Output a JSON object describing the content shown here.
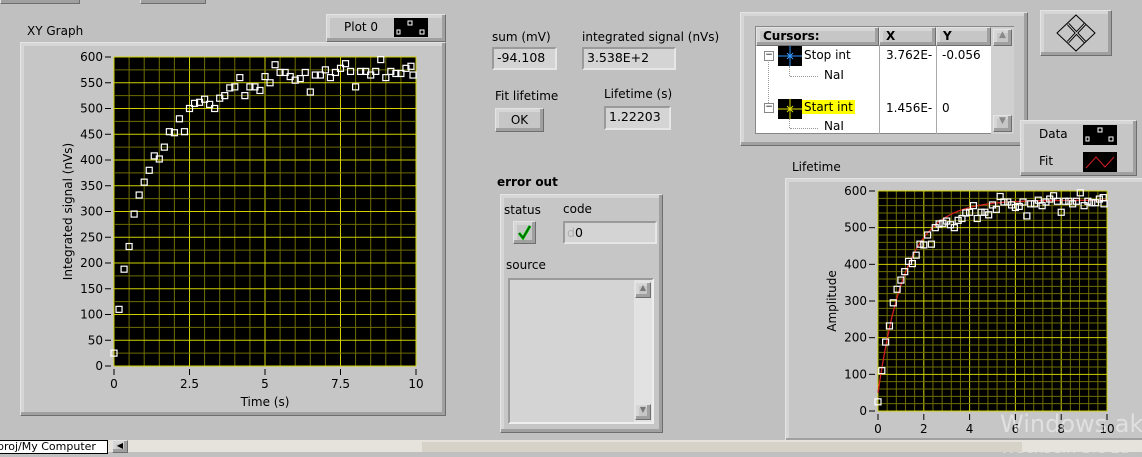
{
  "xy_graph": {
    "label": "XY Graph",
    "legend": {
      "plot_name": "Plot 0"
    },
    "chart_data": {
      "type": "scatter",
      "xlabel": "Time (s)",
      "ylabel": "Integrated signal (nVs)",
      "xlim": [
        0,
        10
      ],
      "ylim": [
        0,
        600
      ],
      "xticks": [
        "0",
        "2.5",
        "5",
        "7.5",
        "10"
      ],
      "yticks": [
        "0",
        "50",
        "100",
        "150",
        "200",
        "250",
        "300",
        "350",
        "400",
        "450",
        "500",
        "550",
        "600"
      ],
      "grid": true,
      "background": "#000000",
      "grid_color": "#c8c800",
      "marker_color": "#ffffff",
      "x": [
        0,
        0.2,
        0.4,
        0.6,
        0.8,
        1.0,
        1.2,
        1.4,
        1.6,
        1.8,
        2.0,
        2.2,
        2.4,
        2.6,
        2.8,
        3.0,
        3.2,
        3.4,
        3.6,
        3.8,
        4.0,
        4.2,
        4.4,
        4.6,
        4.8,
        5.0,
        5.2,
        5.4,
        5.6,
        5.8,
        6.0,
        6.2,
        6.4,
        6.6,
        6.8,
        7.0,
        7.2,
        7.4,
        7.6,
        7.8,
        8.0,
        8.2,
        8.4,
        8.6,
        8.8,
        9.0,
        9.2,
        9.4,
        9.6,
        9.8,
        10.0
      ],
      "y": [
        25,
        110,
        188,
        232,
        295,
        332,
        357,
        380,
        408,
        402,
        425,
        455,
        453,
        480,
        455,
        500,
        510,
        512,
        518,
        508,
        500,
        520,
        525,
        540,
        542,
        560,
        525,
        542,
        542,
        535,
        562,
        550,
        585,
        570,
        570,
        562,
        555,
        558,
        570,
        532,
        565,
        565,
        575,
        560,
        570,
        578,
        587,
        572,
        542,
        572,
        572,
        565,
        572,
        595,
        560,
        572,
        568,
        568,
        578,
        582,
        565
      ]
    }
  },
  "sum": {
    "label": "sum (mV)",
    "value": "-94.108"
  },
  "integrated_signal": {
    "label": "integrated signal (nVs)",
    "value": "3.538E+2"
  },
  "fit_lifetime": {
    "label": "Fit lifetime",
    "button": "OK"
  },
  "lifetime_value": {
    "label": "Lifetime (s)",
    "value": "1.22203"
  },
  "error_out": {
    "label": "error out",
    "status_label": "status",
    "status": true,
    "code_label": "code",
    "code_prefix": "d",
    "code": "0",
    "source_label": "source",
    "source": ""
  },
  "cursors": {
    "headers": [
      "Cursors:",
      "X",
      "Y"
    ],
    "items": [
      {
        "name": "Stop int",
        "x": "3.762E-",
        "y": "-0.056",
        "plot": "NaI",
        "color": "#3399ff",
        "highlight": false
      },
      {
        "name": "Start int",
        "x": "1.456E-",
        "y": "0",
        "plot": "NaI",
        "color": "#e0e000",
        "highlight": true
      }
    ]
  },
  "lifetime_graph": {
    "label": "Lifetime",
    "legend": [
      {
        "name": "Data"
      },
      {
        "name": "Fit",
        "color": "#d02020"
      }
    ],
    "chart_data": {
      "type": "scatter",
      "xlabel": "",
      "ylabel": "Amplitude",
      "xlim": [
        0,
        10
      ],
      "ylim": [
        0,
        600
      ],
      "xticks": [
        "0",
        "2",
        "4",
        "6",
        "8",
        "10"
      ],
      "yticks": [
        "0",
        "100",
        "200",
        "300",
        "400",
        "500",
        "600"
      ],
      "grid": true,
      "series": [
        {
          "name": "Data",
          "type": "scatter",
          "source": "same as XY Graph data"
        },
        {
          "name": "Fit",
          "type": "line",
          "color": "#d02020",
          "model": "y = 575 - 525*exp(-t/1.22203)"
        }
      ]
    }
  },
  "status_bar": {
    "tab": "proj/My Computer"
  },
  "watermark": [
    "Windows aktivieren",
    "Wechseln Sie zu"
  ]
}
